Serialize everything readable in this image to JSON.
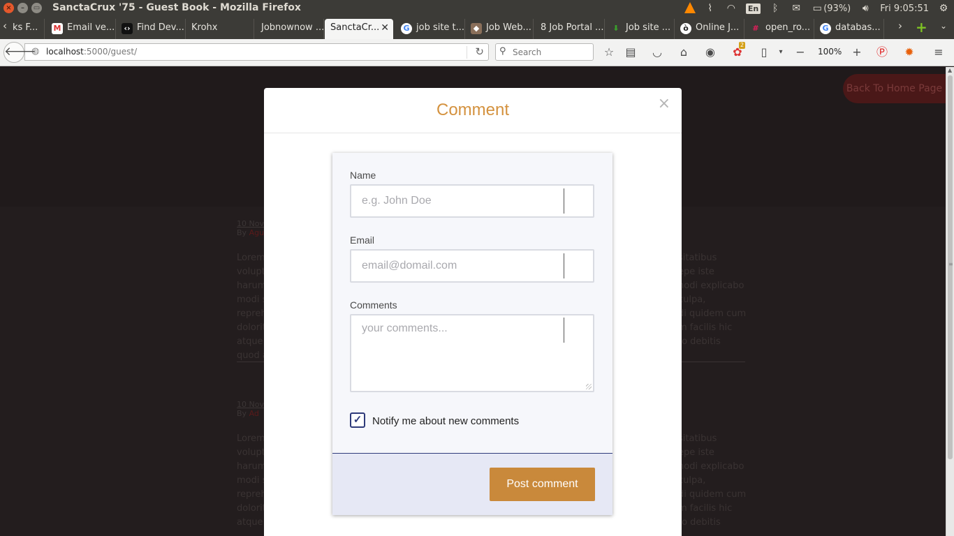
{
  "window": {
    "title": "SanctaCrux '75 - Guest Book - Mozilla Firefox",
    "tray": {
      "keyboard_lang": "En",
      "battery": "(93%)",
      "clock": "Fri  9:05:51"
    }
  },
  "tabs": [
    {
      "label": "ks F...",
      "icon": "bookmark-icon"
    },
    {
      "label": "Email ve...",
      "icon": "gmail-icon"
    },
    {
      "label": "Find Dev...",
      "icon": "code-icon"
    },
    {
      "label": "Krohx",
      "icon": ""
    },
    {
      "label": "Jobnownow ...",
      "icon": ""
    },
    {
      "label": "SanctaCr...",
      "icon": "",
      "active": true
    },
    {
      "label": "job site t...",
      "icon": "google-icon"
    },
    {
      "label": "Job Web...",
      "icon": "job-icon"
    },
    {
      "label": "8 Job Portal ...",
      "icon": ""
    },
    {
      "label": "Job site ...",
      "icon": "download-icon"
    },
    {
      "label": "Online J...",
      "icon": "owl-icon"
    },
    {
      "label": "open_ro...",
      "icon": "slack-icon"
    },
    {
      "label": "databas...",
      "icon": "google-icon"
    }
  ],
  "navbar": {
    "url_host": "localhost",
    "url_rest": ":5000/guest/",
    "search_placeholder": "Search",
    "zoom": "100%",
    "badge_count": "2"
  },
  "page": {
    "home_button": "Back To Home Page",
    "posts": [
      {
        "date": "10 Nove",
        "by": "By",
        "by_name": "Agu",
        "text_left": "Lorem\nvolupt\nharum\nmodi s\nrepreh\ndolorit\natque\nquod a",
        "text_right": "sitatibus\nepe iste\nnodi explicabo\nculpa,\ndi quidem cum\nm facilis hic\nto debitis"
      },
      {
        "date": "10 Nove",
        "by": "By",
        "by_name": "Ad",
        "text_left": "Lorem\nvolupt\nharum\nmodi s\nrepreh\ndolorit\natque",
        "text_right": "sitatibus\nepe iste\nnodi explicabo\nculpa,\ndi quidem cum\nm facilis hic\nto debitis"
      }
    ]
  },
  "modal": {
    "title": "Comment",
    "close_symbol": "×",
    "form": {
      "name_label": "Name",
      "name_placeholder": "e.g. John Doe",
      "email_label": "Email",
      "email_placeholder": "email@domail.com",
      "comments_label": "Comments",
      "comments_placeholder": "your comments...",
      "notify_label": "Notify me about new comments",
      "notify_checked": true,
      "submit_label": "Post comment"
    }
  },
  "colors": {
    "accent": "#c9893b",
    "title": "#d4923f",
    "checkbox": "#2e3a7a",
    "page_bg": "#231d1e"
  }
}
